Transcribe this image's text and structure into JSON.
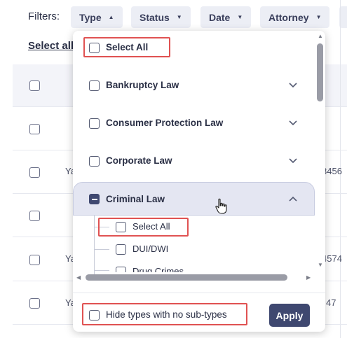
{
  "filters": {
    "label": "Filters:",
    "chips": [
      {
        "label": "Type",
        "expanded": true
      },
      {
        "label": "Status",
        "expanded": false
      },
      {
        "label": "Date",
        "expanded": false
      },
      {
        "label": "Attorney",
        "expanded": false
      }
    ]
  },
  "select_all_link": "Select all",
  "background_rows": {
    "cells": [
      "Ya",
      "3456",
      "Ya",
      "4574",
      "Ya",
      "47"
    ]
  },
  "dropdown": {
    "select_all": "Select All",
    "items": [
      {
        "label": "Bankruptcy Law",
        "expanded": false
      },
      {
        "label": "Consumer Protection Law",
        "expanded": false
      },
      {
        "label": "Corporate Law",
        "expanded": false
      },
      {
        "label": "Criminal Law",
        "expanded": true,
        "state": "indeterminate"
      }
    ],
    "sub_items": [
      "Select All",
      "DUI/DWI",
      "Drug Crimes"
    ],
    "hide_label": "Hide types with no sub-types",
    "apply_label": "Apply"
  },
  "colors": {
    "accent": "#3f4870",
    "highlight": "#e05252",
    "chip_bg": "#eceef5",
    "expanded_bg": "#e4e6f2"
  },
  "icons": [
    "caret-up-icon",
    "caret-down-icon",
    "chevron-down-icon",
    "chevron-up-icon",
    "hand-cursor-icon"
  ]
}
